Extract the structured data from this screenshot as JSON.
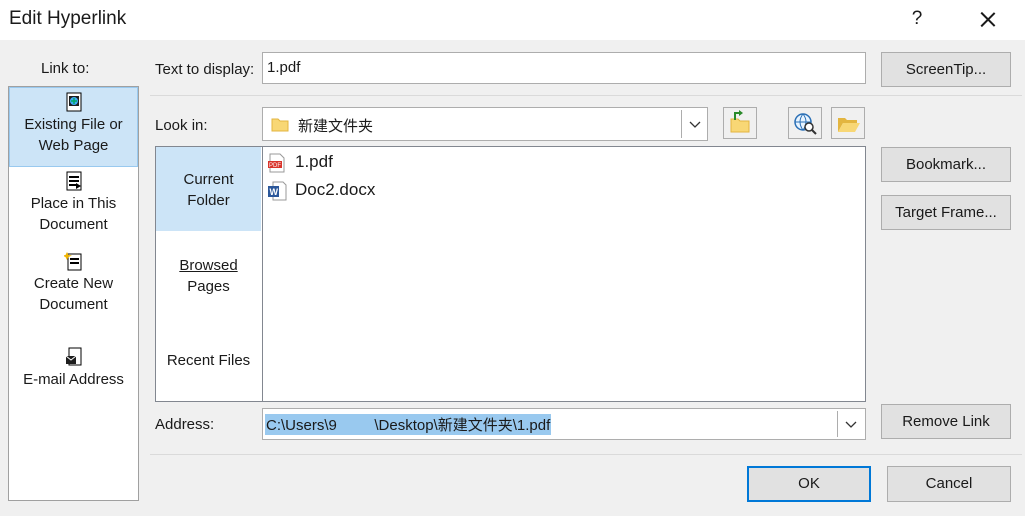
{
  "dialog": {
    "title": "Edit Hyperlink",
    "help_glyph": "?"
  },
  "link_to": {
    "label": "Link to:",
    "items": [
      {
        "label_1": "Existing File or",
        "label_2": "Web Page",
        "selected": true,
        "icon": "existing-file-icon"
      },
      {
        "label_1": "Place in This",
        "label_2": "Document",
        "selected": false,
        "icon": "place-in-document-icon"
      },
      {
        "label_1": "Create New",
        "label_2": "Document",
        "selected": false,
        "icon": "new-document-icon"
      },
      {
        "label_1": "E-mail Address",
        "label_2": "",
        "selected": false,
        "icon": "email-icon"
      }
    ]
  },
  "text_to_display": {
    "label": "Text to display:",
    "value": "1.pdf"
  },
  "look_in": {
    "label": "Look in:",
    "value": "新建文件夹"
  },
  "nav": {
    "items": [
      {
        "label_1": "Current",
        "label_2": "Folder",
        "selected": true
      },
      {
        "label_1": "Browsed",
        "label_2": "Pages",
        "selected": false
      },
      {
        "label_1": "Recent Files",
        "label_2": "",
        "selected": false
      }
    ]
  },
  "files": [
    {
      "name": "1.pdf",
      "type": "pdf"
    },
    {
      "name": "Doc2.docx",
      "type": "word"
    }
  ],
  "address": {
    "label": "Address:",
    "value": "C:\\Users\\9     \\Desktop\\新建文件夹\\1.pdf"
  },
  "buttons": {
    "screentip": "ScreenTip...",
    "bookmark": "Bookmark...",
    "target_frame": "Target Frame...",
    "remove_link": "Remove Link",
    "ok": "OK",
    "cancel": "Cancel"
  },
  "colors": {
    "selection": "#cce4f7",
    "accent": "#0078d7",
    "address_highlight": "#99c9ef"
  }
}
